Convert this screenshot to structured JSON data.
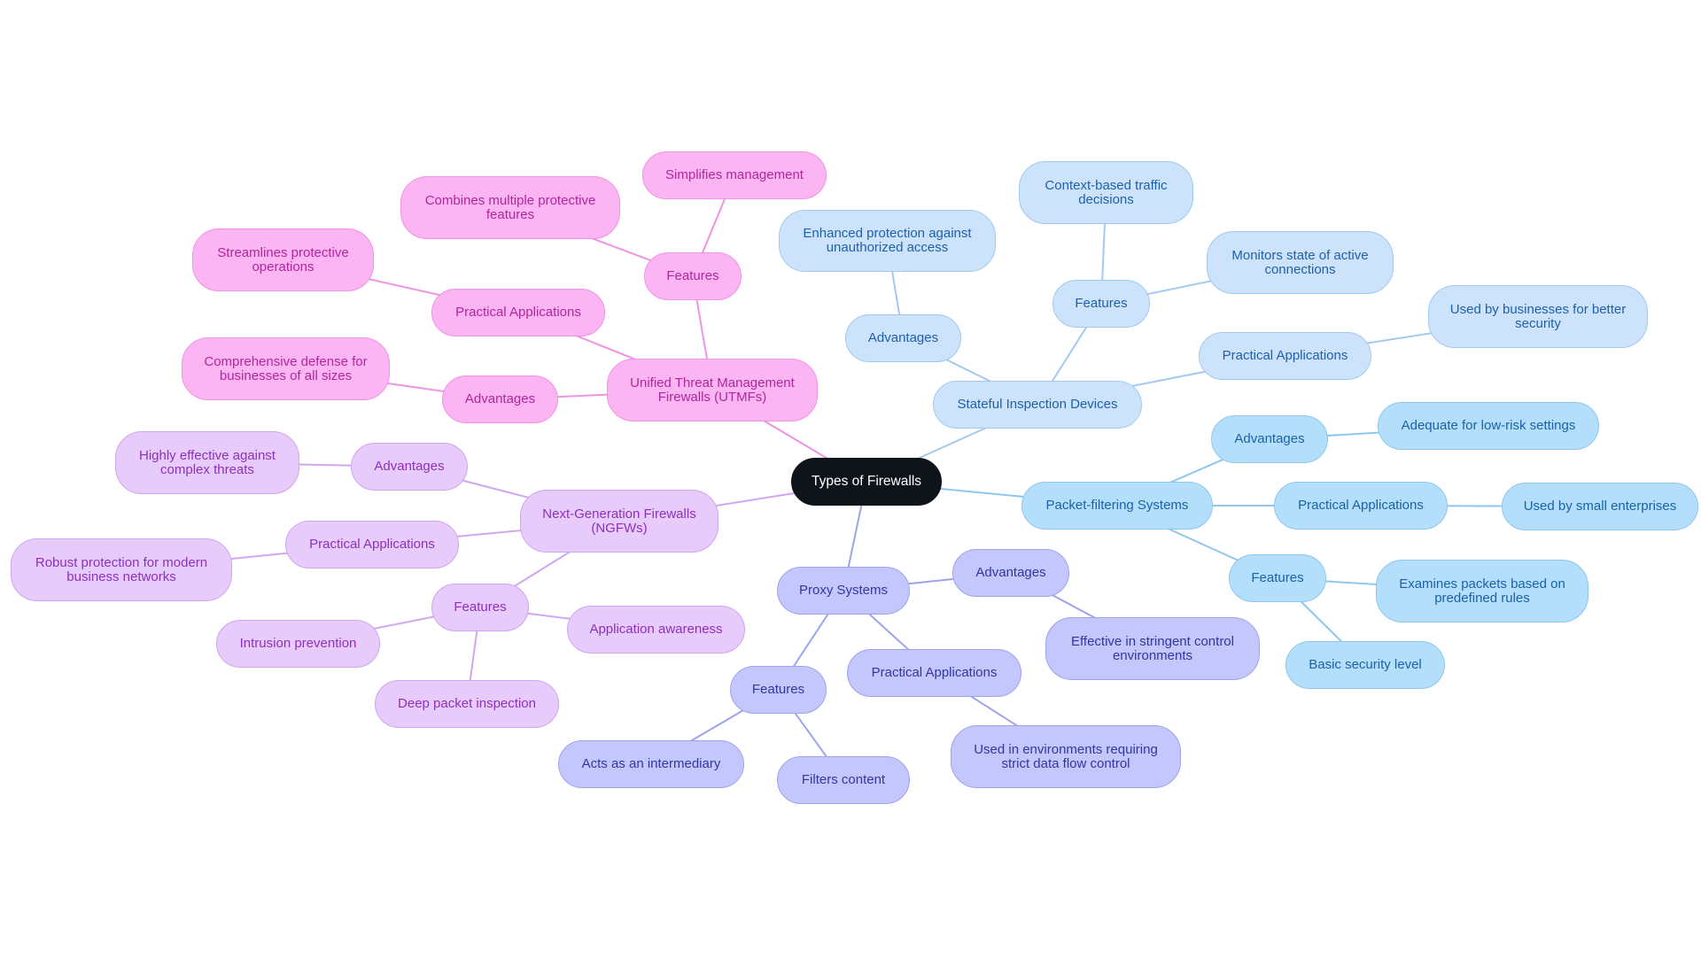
{
  "title": "Types of Firewalls",
  "colors": {
    "root": "#0f141a",
    "stateful": "#a3c9ef",
    "packet": "#8fc6ec",
    "proxy": "#9ea3ee",
    "ngfw": "#cfa6ef",
    "utmf": "#ee94e3"
  },
  "nodes": {
    "root": "Types of Firewalls",
    "stateful": "Stateful Inspection Devices",
    "stateful_adv": "Advantages",
    "stateful_adv_1": "Enhanced protection against\nunauthorized access",
    "stateful_feat": "Features",
    "stateful_feat_1": "Context-based traffic\ndecisions",
    "stateful_feat_2": "Monitors state of active\nconnections",
    "stateful_app": "Practical Applications",
    "stateful_app_1": "Used by businesses for better\nsecurity",
    "packet": "Packet-filtering Systems",
    "packet_adv": "Advantages",
    "packet_adv_1": "Adequate for low-risk settings",
    "packet_app": "Practical Applications",
    "packet_app_1": "Used by small enterprises",
    "packet_feat": "Features",
    "packet_feat_1": "Examines packets based on\npredefined rules",
    "packet_feat_2": "Basic security level",
    "proxy": "Proxy Systems",
    "proxy_adv": "Advantages",
    "proxy_adv_1": "Effective in stringent control\nenvironments",
    "proxy_app": "Practical Applications",
    "proxy_app_1": "Used in environments requiring\nstrict data flow control",
    "proxy_feat": "Features",
    "proxy_feat_1": "Acts as an intermediary",
    "proxy_feat_2": "Filters content",
    "ngfw": "Next-Generation Firewalls\n(NGFWs)",
    "ngfw_adv": "Advantages",
    "ngfw_adv_1": "Highly effective against\ncomplex threats",
    "ngfw_app": "Practical Applications",
    "ngfw_app_1": "Robust protection for modern\nbusiness networks",
    "ngfw_feat": "Features",
    "ngfw_feat_1": "Application awareness",
    "ngfw_feat_2": "Intrusion prevention",
    "ngfw_feat_3": "Deep packet inspection",
    "utmf": "Unified Threat Management\nFirewalls (UTMFs)",
    "utmf_adv": "Advantages",
    "utmf_adv_1": "Comprehensive defense for\nbusinesses of all sizes",
    "utmf_app": "Practical Applications",
    "utmf_app_1": "Streamlines protective\noperations",
    "utmf_feat": "Features",
    "utmf_feat_1": "Combines multiple protective\nfeatures",
    "utmf_feat_2": "Simplifies management"
  },
  "edges": [
    [
      "root",
      "stateful",
      "stateful"
    ],
    [
      "stateful",
      "stateful_adv",
      "stateful"
    ],
    [
      "stateful_adv",
      "stateful_adv_1",
      "stateful"
    ],
    [
      "stateful",
      "stateful_feat",
      "stateful"
    ],
    [
      "stateful_feat",
      "stateful_feat_1",
      "stateful"
    ],
    [
      "stateful_feat",
      "stateful_feat_2",
      "stateful"
    ],
    [
      "stateful",
      "stateful_app",
      "stateful"
    ],
    [
      "stateful_app",
      "stateful_app_1",
      "stateful"
    ],
    [
      "root",
      "packet",
      "packet"
    ],
    [
      "packet",
      "packet_adv",
      "packet"
    ],
    [
      "packet_adv",
      "packet_adv_1",
      "packet"
    ],
    [
      "packet",
      "packet_app",
      "packet"
    ],
    [
      "packet_app",
      "packet_app_1",
      "packet"
    ],
    [
      "packet",
      "packet_feat",
      "packet"
    ],
    [
      "packet_feat",
      "packet_feat_1",
      "packet"
    ],
    [
      "packet_feat",
      "packet_feat_2",
      "packet"
    ],
    [
      "root",
      "proxy",
      "proxy"
    ],
    [
      "proxy",
      "proxy_adv",
      "proxy"
    ],
    [
      "proxy_adv",
      "proxy_adv_1",
      "proxy"
    ],
    [
      "proxy",
      "proxy_app",
      "proxy"
    ],
    [
      "proxy_app",
      "proxy_app_1",
      "proxy"
    ],
    [
      "proxy",
      "proxy_feat",
      "proxy"
    ],
    [
      "proxy_feat",
      "proxy_feat_1",
      "proxy"
    ],
    [
      "proxy_feat",
      "proxy_feat_2",
      "proxy"
    ],
    [
      "root",
      "ngfw",
      "ngfw"
    ],
    [
      "ngfw",
      "ngfw_adv",
      "ngfw"
    ],
    [
      "ngfw_adv",
      "ngfw_adv_1",
      "ngfw"
    ],
    [
      "ngfw",
      "ngfw_app",
      "ngfw"
    ],
    [
      "ngfw_app",
      "ngfw_app_1",
      "ngfw"
    ],
    [
      "ngfw",
      "ngfw_feat",
      "ngfw"
    ],
    [
      "ngfw_feat",
      "ngfw_feat_1",
      "ngfw"
    ],
    [
      "ngfw_feat",
      "ngfw_feat_2",
      "ngfw"
    ],
    [
      "ngfw_feat",
      "ngfw_feat_3",
      "ngfw"
    ],
    [
      "root",
      "utmf",
      "utmf"
    ],
    [
      "utmf",
      "utmf_adv",
      "utmf"
    ],
    [
      "utmf_adv",
      "utmf_adv_1",
      "utmf"
    ],
    [
      "utmf",
      "utmf_app",
      "utmf"
    ],
    [
      "utmf_app",
      "utmf_app_1",
      "utmf"
    ],
    [
      "utmf",
      "utmf_feat",
      "utmf"
    ],
    [
      "utmf_feat",
      "utmf_feat_1",
      "utmf"
    ],
    [
      "utmf_feat",
      "utmf_feat_2",
      "utmf"
    ]
  ]
}
